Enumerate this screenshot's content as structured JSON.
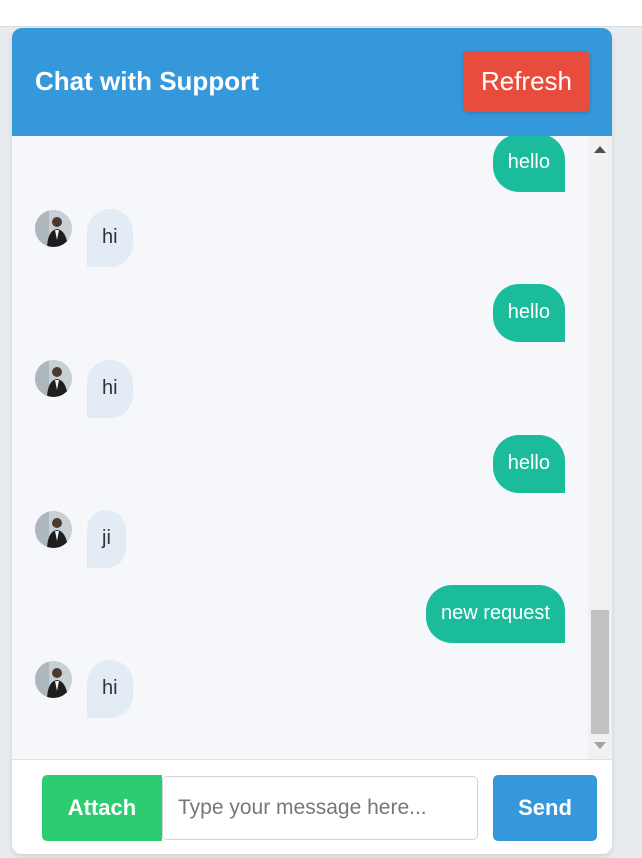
{
  "header": {
    "title": "Chat with Support",
    "refresh_label": "Refresh"
  },
  "messages": [
    {
      "sender": "user",
      "text": "hello"
    },
    {
      "sender": "support",
      "text": "hi"
    },
    {
      "sender": "user",
      "text": "hello"
    },
    {
      "sender": "support",
      "text": "hi"
    },
    {
      "sender": "user",
      "text": "hello"
    },
    {
      "sender": "support",
      "text": "ji"
    },
    {
      "sender": "user",
      "text": "new request"
    },
    {
      "sender": "support",
      "text": "hi"
    }
  ],
  "composer": {
    "attach_label": "Attach",
    "placeholder": "Type your message here...",
    "value": "",
    "send_label": "Send"
  },
  "colors": {
    "header": "#3498db",
    "refresh": "#e74c3c",
    "user_bubble": "#1abc9c",
    "support_bubble": "#e3ebf4",
    "attach": "#2ecc71",
    "send": "#3498db"
  },
  "icons": {
    "support_avatar": "support-agent-avatar"
  }
}
